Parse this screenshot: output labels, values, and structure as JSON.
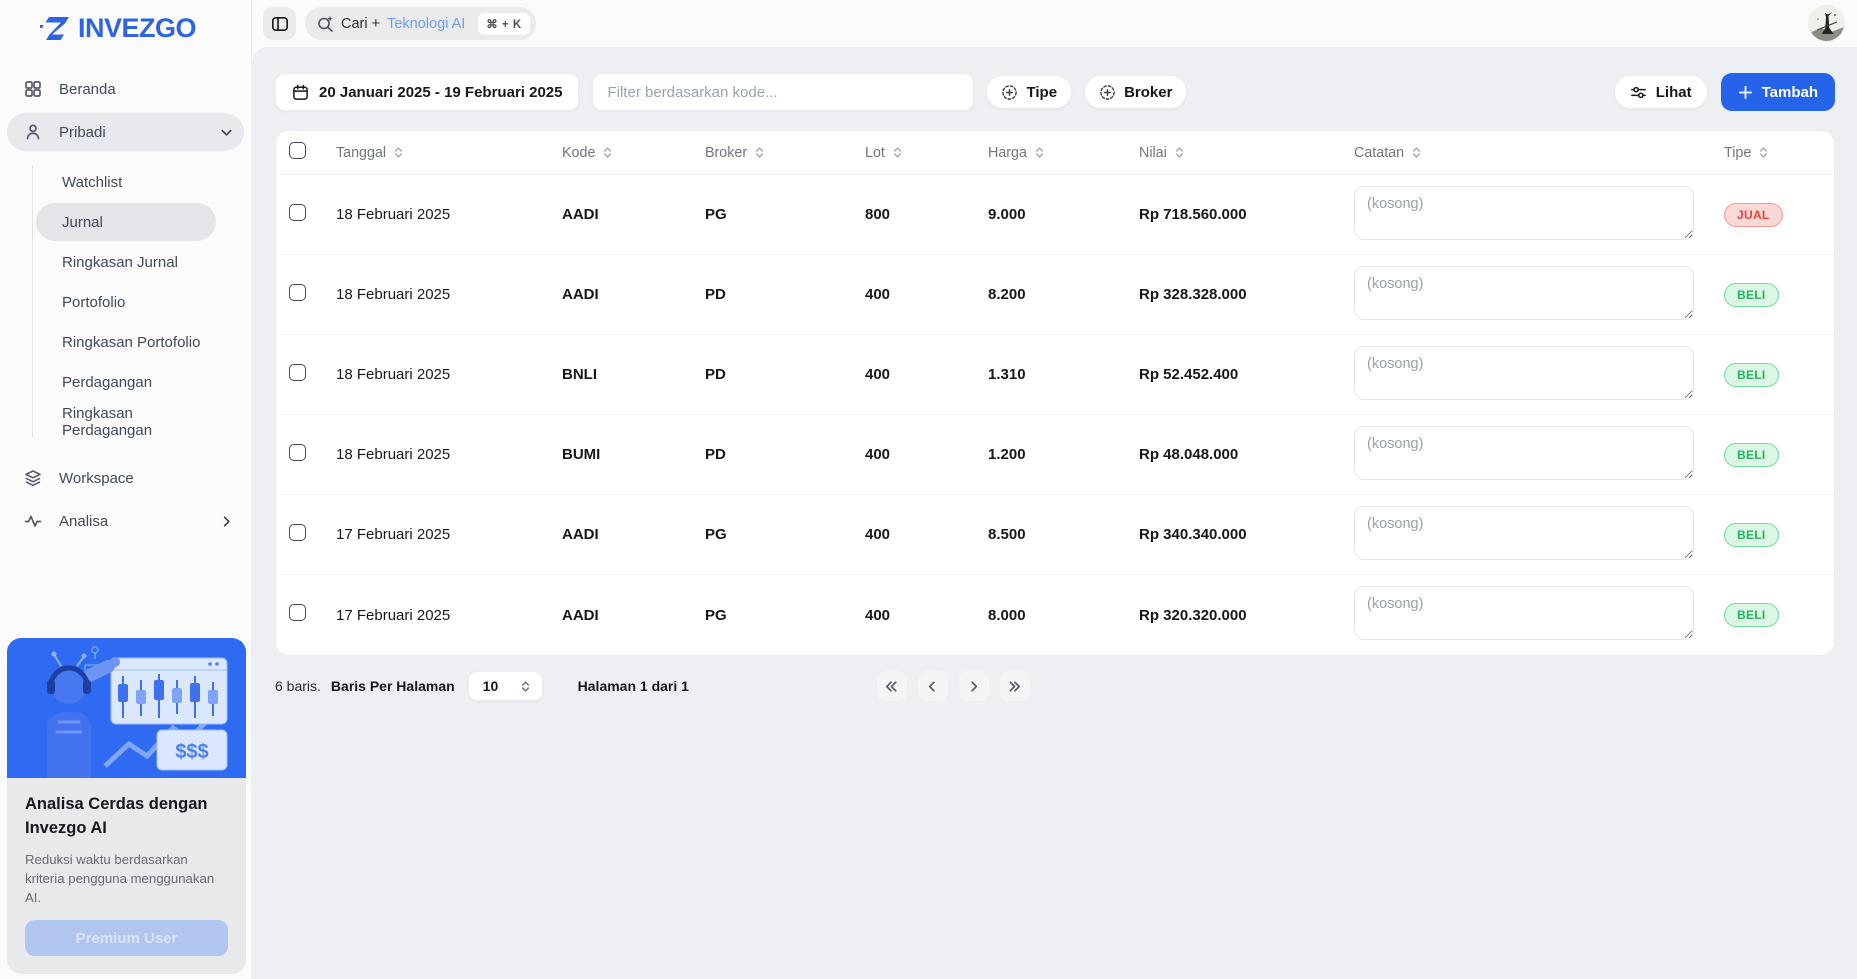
{
  "brand": {
    "name": "INVEZGO"
  },
  "topbar": {
    "search_prefix": "Cari +",
    "search_highlight": "Teknologi AI",
    "shortcut": "⌘ + K"
  },
  "sidebar": {
    "items": [
      {
        "label": "Beranda"
      },
      {
        "label": "Pribadi"
      },
      {
        "label": "Workspace"
      },
      {
        "label": "Analisa"
      }
    ],
    "pribadi_children": [
      {
        "label": "Watchlist",
        "state": ""
      },
      {
        "label": "Jurnal",
        "state": "active"
      },
      {
        "label": "Ringkasan Jurnal",
        "state": ""
      },
      {
        "label": "Portofolio",
        "state": ""
      },
      {
        "label": "Ringkasan Portofolio",
        "state": ""
      },
      {
        "label": "Perdagangan",
        "state": ""
      },
      {
        "label": "Ringkasan Perdagangan",
        "state": ""
      }
    ],
    "promo": {
      "title": "Analisa Cerdas dengan Invezgo AI",
      "body": "Reduksi waktu berdasarkan kriteria pengguna menggunakan AI.",
      "button": "Premium User"
    }
  },
  "toolbar": {
    "date_range": "20 Januari 2025 - 19 Februari 2025",
    "filter_placeholder": "Filter berdasarkan kode...",
    "tipe_label": "Tipe",
    "broker_label": "Broker",
    "lihat_label": "Lihat",
    "tambah_label": "Tambah"
  },
  "table": {
    "headers": [
      "Tanggal",
      "Kode",
      "Broker",
      "Lot",
      "Harga",
      "Nilai",
      "Catatan",
      "Tipe"
    ],
    "rows": [
      {
        "tanggal": "18 Februari 2025",
        "kode": "AADI",
        "broker": "PG",
        "lot": "800",
        "harga": "9.000",
        "nilai": "Rp 718.560.000",
        "catatan_placeholder": "(kosong)",
        "tipe": "JUAL"
      },
      {
        "tanggal": "18 Februari 2025",
        "kode": "AADI",
        "broker": "PD",
        "lot": "400",
        "harga": "8.200",
        "nilai": "Rp 328.328.000",
        "catatan_placeholder": "(kosong)",
        "tipe": "BELI"
      },
      {
        "tanggal": "18 Februari 2025",
        "kode": "BNLI",
        "broker": "PD",
        "lot": "400",
        "harga": "1.310",
        "nilai": "Rp 52.452.400",
        "catatan_placeholder": "(kosong)",
        "tipe": "BELI"
      },
      {
        "tanggal": "18 Februari 2025",
        "kode": "BUMI",
        "broker": "PD",
        "lot": "400",
        "harga": "1.200",
        "nilai": "Rp 48.048.000",
        "catatan_placeholder": "(kosong)",
        "tipe": "BELI"
      },
      {
        "tanggal": "17 Februari 2025",
        "kode": "AADI",
        "broker": "PG",
        "lot": "400",
        "harga": "8.500",
        "nilai": "Rp 340.340.000",
        "catatan_placeholder": "(kosong)",
        "tipe": "BELI"
      },
      {
        "tanggal": "17 Februari 2025",
        "kode": "AADI",
        "broker": "PG",
        "lot": "400",
        "harga": "8.000",
        "nilai": "Rp 320.320.000",
        "catatan_placeholder": "(kosong)",
        "tipe": "BELI"
      }
    ]
  },
  "footer": {
    "rows_count_text": "6 baris.",
    "per_page_label": "Baris Per Halaman",
    "per_page_value": "10",
    "page_text": "Halaman 1 dari 1"
  },
  "colors": {
    "accent_blue": "#2563eb",
    "jual_red": "#e8443c",
    "beli_green": "#27b35c",
    "main_bg": "#edeff2"
  }
}
